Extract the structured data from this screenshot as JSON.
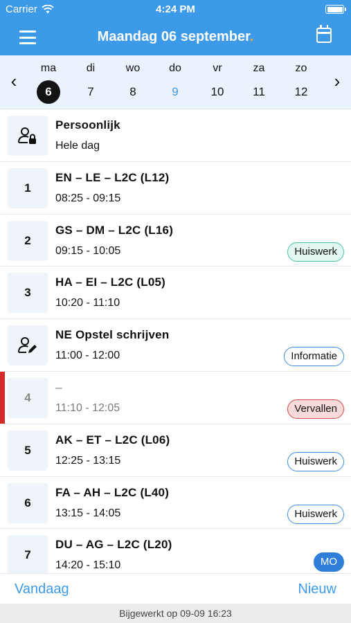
{
  "status": {
    "carrier": "Carrier",
    "time": "4:24 PM"
  },
  "nav": {
    "title": "Maandag 06 september",
    "title_dot": "."
  },
  "week": {
    "days": [
      {
        "label": "ma",
        "num": "6"
      },
      {
        "label": "di",
        "num": "7"
      },
      {
        "label": "wo",
        "num": "8"
      },
      {
        "label": "do",
        "num": "9"
      },
      {
        "label": "vr",
        "num": "10"
      },
      {
        "label": "za",
        "num": "11"
      },
      {
        "label": "zo",
        "num": "12"
      }
    ]
  },
  "lessons": [
    {
      "hour": "",
      "icon": "person-lock-icon",
      "title": "Persoonlijk",
      "time": "Hele dag",
      "badge": ""
    },
    {
      "hour": "1",
      "title": "EN – LE – L2C (L12)",
      "time": "08:25 - 09:15",
      "badge": ""
    },
    {
      "hour": "2",
      "title": "GS – DM – L2C (L16)",
      "time": "09:15 - 10:05",
      "badge": "Huiswerk"
    },
    {
      "hour": "3",
      "title": "HA – EI – L2C (L05)",
      "time": "10:20 - 11:10",
      "badge": ""
    },
    {
      "hour": "",
      "icon": "person-edit-icon",
      "title": "NE Opstel schrijven",
      "time": "11:00 - 12:00",
      "badge": "Informatie"
    },
    {
      "hour": "4",
      "title": "–",
      "time": "11:10 - 12:05",
      "badge": "Vervallen"
    },
    {
      "hour": "5",
      "title": "AK – ET – L2C (L06)",
      "time": "12:25 - 13:15",
      "badge": "Huiswerk"
    },
    {
      "hour": "6",
      "title": "FA – AH – L2C (L40)",
      "time": "13:15 - 14:05",
      "badge": "Huiswerk"
    },
    {
      "hour": "7",
      "title": "DU – AG – L2C (L20)",
      "time": "14:20 - 15:10",
      "badge": "MO"
    }
  ],
  "bottom": {
    "today_label": "Vandaag",
    "new_label": "Nieuw"
  },
  "footer": {
    "updated": "Bijgewerkt op 09-09 16:23"
  },
  "colors": {
    "accent": "#3d9ae9",
    "cancel": "#d32a2a",
    "dot": "#f5a623"
  }
}
